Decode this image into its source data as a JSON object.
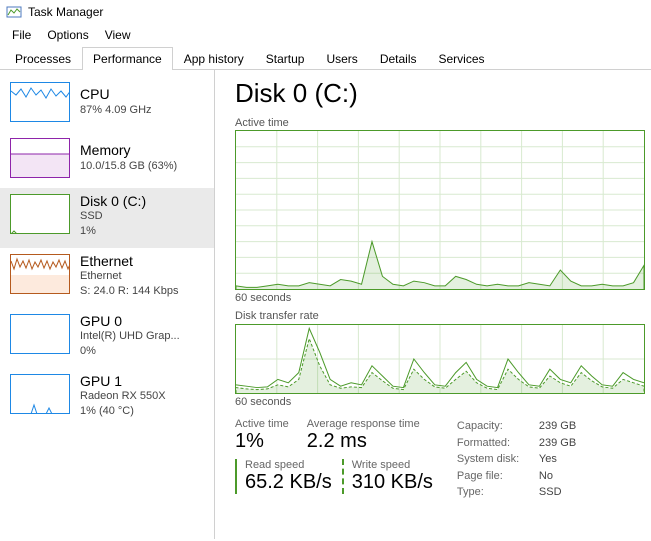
{
  "window": {
    "title": "Task Manager"
  },
  "menu": {
    "file": "File",
    "options": "Options",
    "view": "View"
  },
  "tabs": [
    "Processes",
    "Performance",
    "App history",
    "Startup",
    "Users",
    "Details",
    "Services"
  ],
  "active_tab": 1,
  "sidebar": {
    "items": [
      {
        "title": "CPU",
        "sub": "87% 4.09 GHz",
        "sub2": "",
        "color": "#1e88e5",
        "selected": false
      },
      {
        "title": "Memory",
        "sub": "10.0/15.8 GB (63%)",
        "sub2": "",
        "color": "#8e24aa",
        "selected": false
      },
      {
        "title": "Disk 0 (C:)",
        "sub": "SSD",
        "sub2": "1%",
        "color": "#4c9a2a",
        "selected": true
      },
      {
        "title": "Ethernet",
        "sub": "Ethernet",
        "sub2": "S: 24.0 R: 144 Kbps",
        "color": "#b55a1e",
        "selected": false
      },
      {
        "title": "GPU 0",
        "sub": "Intel(R) UHD Grap...",
        "sub2": "0%",
        "color": "#1e88e5",
        "selected": false
      },
      {
        "title": "GPU 1",
        "sub": "Radeon RX 550X",
        "sub2": "1% (40 °C)",
        "color": "#1e88e5",
        "selected": false
      }
    ]
  },
  "detail": {
    "title": "Disk 0 (C:)",
    "chart1_label": "Active time",
    "chart2_label": "Disk transfer rate",
    "axis_label": "60 seconds",
    "stats": {
      "active_time_label": "Active time",
      "active_time": "1%",
      "avg_resp_label": "Average response time",
      "avg_resp": "2.2 ms",
      "read_label": "Read speed",
      "read": "65.2 KB/s",
      "write_label": "Write speed",
      "write": "310 KB/s"
    },
    "info": [
      {
        "k": "Capacity:",
        "v": "239 GB"
      },
      {
        "k": "Formatted:",
        "v": "239 GB"
      },
      {
        "k": "System disk:",
        "v": "Yes"
      },
      {
        "k": "Page file:",
        "v": "No"
      },
      {
        "k": "Type:",
        "v": "SSD"
      }
    ]
  },
  "chart_data": [
    {
      "type": "area",
      "title": "Active time",
      "ylabel": "%",
      "ylim": [
        0,
        100
      ],
      "xlabel": "seconds ago",
      "xlim": [
        60,
        0
      ],
      "values": [
        2,
        1,
        1,
        2,
        3,
        2,
        2,
        4,
        3,
        2,
        6,
        5,
        3,
        30,
        8,
        3,
        2,
        5,
        4,
        2,
        2,
        8,
        6,
        3,
        2,
        3,
        2,
        2,
        4,
        3,
        2,
        12,
        5,
        2,
        2,
        3,
        2,
        2,
        4,
        15
      ]
    },
    {
      "type": "line",
      "title": "Disk transfer rate",
      "ylabel": "KB/s",
      "ylim": [
        0,
        1000
      ],
      "xlabel": "seconds ago",
      "xlim": [
        60,
        0
      ],
      "series": [
        {
          "name": "Read",
          "values": [
            120,
            100,
            80,
            90,
            200,
            150,
            300,
            950,
            600,
            200,
            100,
            150,
            120,
            400,
            250,
            100,
            80,
            500,
            300,
            120,
            100,
            300,
            450,
            200,
            100,
            80,
            500,
            300,
            120,
            100,
            350,
            200,
            150,
            400,
            250,
            120,
            100,
            300,
            200,
            150
          ]
        },
        {
          "name": "Write",
          "values": [
            80,
            60,
            50,
            60,
            120,
            90,
            200,
            800,
            400,
            120,
            70,
            90,
            80,
            300,
            180,
            70,
            50,
            350,
            200,
            90,
            70,
            200,
            320,
            150,
            70,
            50,
            350,
            200,
            90,
            70,
            250,
            150,
            100,
            300,
            180,
            90,
            70,
            200,
            150,
            100
          ]
        }
      ]
    }
  ]
}
